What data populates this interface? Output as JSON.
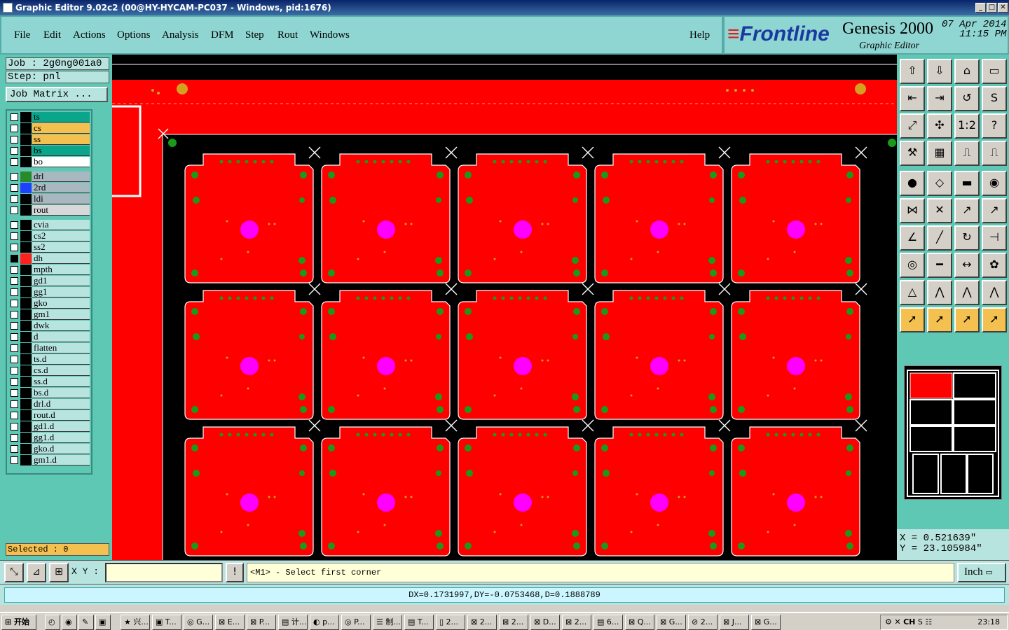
{
  "window": {
    "title": "Graphic Editor 9.02c2 (00@HY-HYCAM-PC037 - Windows, pid:1676)"
  },
  "menu": [
    "File",
    "Edit",
    "Actions",
    "Options",
    "Analysis",
    "DFM",
    "Step",
    "Rout",
    "Windows"
  ],
  "help_label": "Help",
  "logo": {
    "brand": "Frontline",
    "product": "Genesis 2000",
    "subtitle": "Graphic Editor",
    "date": "07 Apr 2014",
    "time": "11:15 PM"
  },
  "job": {
    "job_label": "Job : 2g0ng001a0",
    "step_label": "Step: pnl",
    "matrix_button": "Job Matrix ..."
  },
  "layers": [
    {
      "name": "ts",
      "bg": "#0aa58a",
      "sw": "#000"
    },
    {
      "name": "cs",
      "bg": "#f4c050",
      "sw": "#000"
    },
    {
      "name": "ss",
      "bg": "#f4c050",
      "sw": "#000"
    },
    {
      "name": "bs",
      "bg": "#0aa58a",
      "sw": "#000"
    },
    {
      "name": "bo",
      "bg": "#ffffff",
      "sw": "#000"
    },
    {
      "name": "drl",
      "bg": "#a8b8c0",
      "sw": "#2a8a2a",
      "gap": true
    },
    {
      "name": "2rd",
      "bg": "#a8b8c0",
      "sw": "#2040ff"
    },
    {
      "name": "ldi",
      "bg": "#a8b8c0",
      "sw": "#000"
    },
    {
      "name": "rout",
      "bg": "#d8d8d8",
      "sw": "#000"
    },
    {
      "name": "cvia",
      "bg": "#b8e4e0",
      "sw": "#000",
      "gap": true
    },
    {
      "name": "cs2",
      "bg": "#b8e4e0",
      "sw": "#000"
    },
    {
      "name": "ss2",
      "bg": "#b8e4e0",
      "sw": "#000"
    },
    {
      "name": "dh",
      "bg": "#b8e4e0",
      "sw": "#ff2020",
      "checked": true
    },
    {
      "name": "mpth",
      "bg": "#b8e4e0",
      "sw": "#000"
    },
    {
      "name": "gd1",
      "bg": "#b8e4e0",
      "sw": "#000"
    },
    {
      "name": "gg1",
      "bg": "#b8e4e0",
      "sw": "#000"
    },
    {
      "name": "gko",
      "bg": "#b8e4e0",
      "sw": "#000"
    },
    {
      "name": "gm1",
      "bg": "#b8e4e0",
      "sw": "#000"
    },
    {
      "name": "dwk",
      "bg": "#b8e4e0",
      "sw": "#000"
    },
    {
      "name": "d",
      "bg": "#b8e4e0",
      "sw": "#000"
    },
    {
      "name": "flatten",
      "bg": "#b8e4e0",
      "sw": "#000"
    },
    {
      "name": "ts.d",
      "bg": "#b8e4e0",
      "sw": "#000"
    },
    {
      "name": "cs.d",
      "bg": "#b8e4e0",
      "sw": "#000"
    },
    {
      "name": "ss.d",
      "bg": "#b8e4e0",
      "sw": "#000"
    },
    {
      "name": "bs.d",
      "bg": "#b8e4e0",
      "sw": "#000"
    },
    {
      "name": "drl.d",
      "bg": "#b8e4e0",
      "sw": "#000"
    },
    {
      "name": "rout.d",
      "bg": "#b8e4e0",
      "sw": "#000"
    },
    {
      "name": "gd1.d",
      "bg": "#b8e4e0",
      "sw": "#000"
    },
    {
      "name": "gg1.d",
      "bg": "#b8e4e0",
      "sw": "#000"
    },
    {
      "name": "gko.d",
      "bg": "#b8e4e0",
      "sw": "#000"
    },
    {
      "name": "gm1.d",
      "bg": "#b8e4e0",
      "sw": "#000"
    }
  ],
  "selected_label": "Selected : 0",
  "coords": {
    "x": "X = 0.521639\"",
    "y": "Y = 23.105984\""
  },
  "command": {
    "xy_label": "X Y :",
    "xy_value": "",
    "excl": "!",
    "prompt": "<M1> - Select first corner",
    "unit": "Inch"
  },
  "status": "DX=0.1731997,DY=-0.0753468,D=0.1888789",
  "colors": {
    "copper": "#ff0000",
    "pad": "#1a9a1a",
    "hole": "#ff00ff",
    "board_bg": "#000000",
    "panel": "#5fc8b4"
  },
  "taskbar": {
    "start_label": "开始",
    "tasks": [
      "兴...",
      "T...",
      "G...",
      "E...",
      "P...",
      "计...",
      "p...",
      "P...",
      "制...",
      "T...",
      "2...",
      "2...",
      "2...",
      "D...",
      "2...",
      "6...",
      "Q...",
      "G...",
      "2...",
      "J...",
      "G..."
    ],
    "clock": "23:18",
    "lang": "CH"
  }
}
